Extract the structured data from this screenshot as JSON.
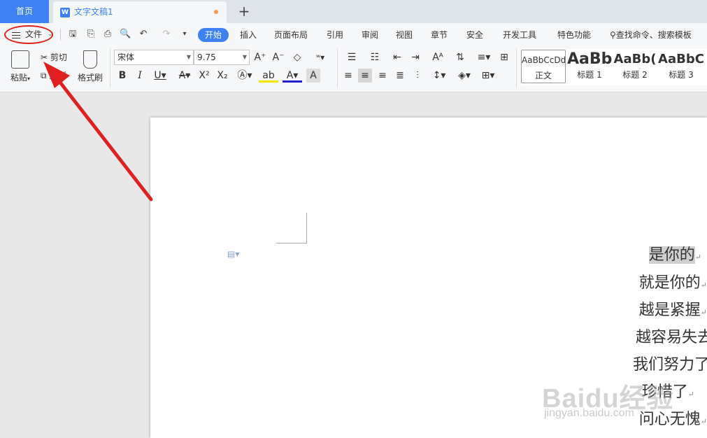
{
  "tabs": {
    "home": "首页",
    "document": "文字文稿1",
    "new_tab": "+"
  },
  "menu": {
    "file": "文件",
    "tabs": [
      "开始",
      "插入",
      "页面布局",
      "引用",
      "审阅",
      "视图",
      "章节",
      "安全",
      "开发工具",
      "特色功能"
    ],
    "active_tab": "开始",
    "search": "查找命令、搜索模板"
  },
  "ribbon": {
    "paste": "粘贴",
    "cut": "剪切",
    "copy": "复制",
    "format_painter": "格式刷",
    "font_name": "宋体",
    "font_size": "9.75",
    "styles": [
      {
        "preview": "AaBbCcDd",
        "name": "正文"
      },
      {
        "preview": "AaBb",
        "name": "标题 1"
      },
      {
        "preview": "AaBb(",
        "name": "标题 2"
      },
      {
        "preview": "AaBbC",
        "name": "标题 3"
      }
    ]
  },
  "document": {
    "lines": [
      "是你的",
      "就是你的",
      "越是紧握",
      "越容易失去",
      "我们努力了",
      "珍惜了",
      "问心无愧"
    ],
    "selected_line_index": 0
  },
  "watermark": {
    "brand": "Baidu经验",
    "url": "jingyan.baidu.com"
  },
  "colors": {
    "accent": "#3d82f5",
    "annotation": "#e02020"
  }
}
